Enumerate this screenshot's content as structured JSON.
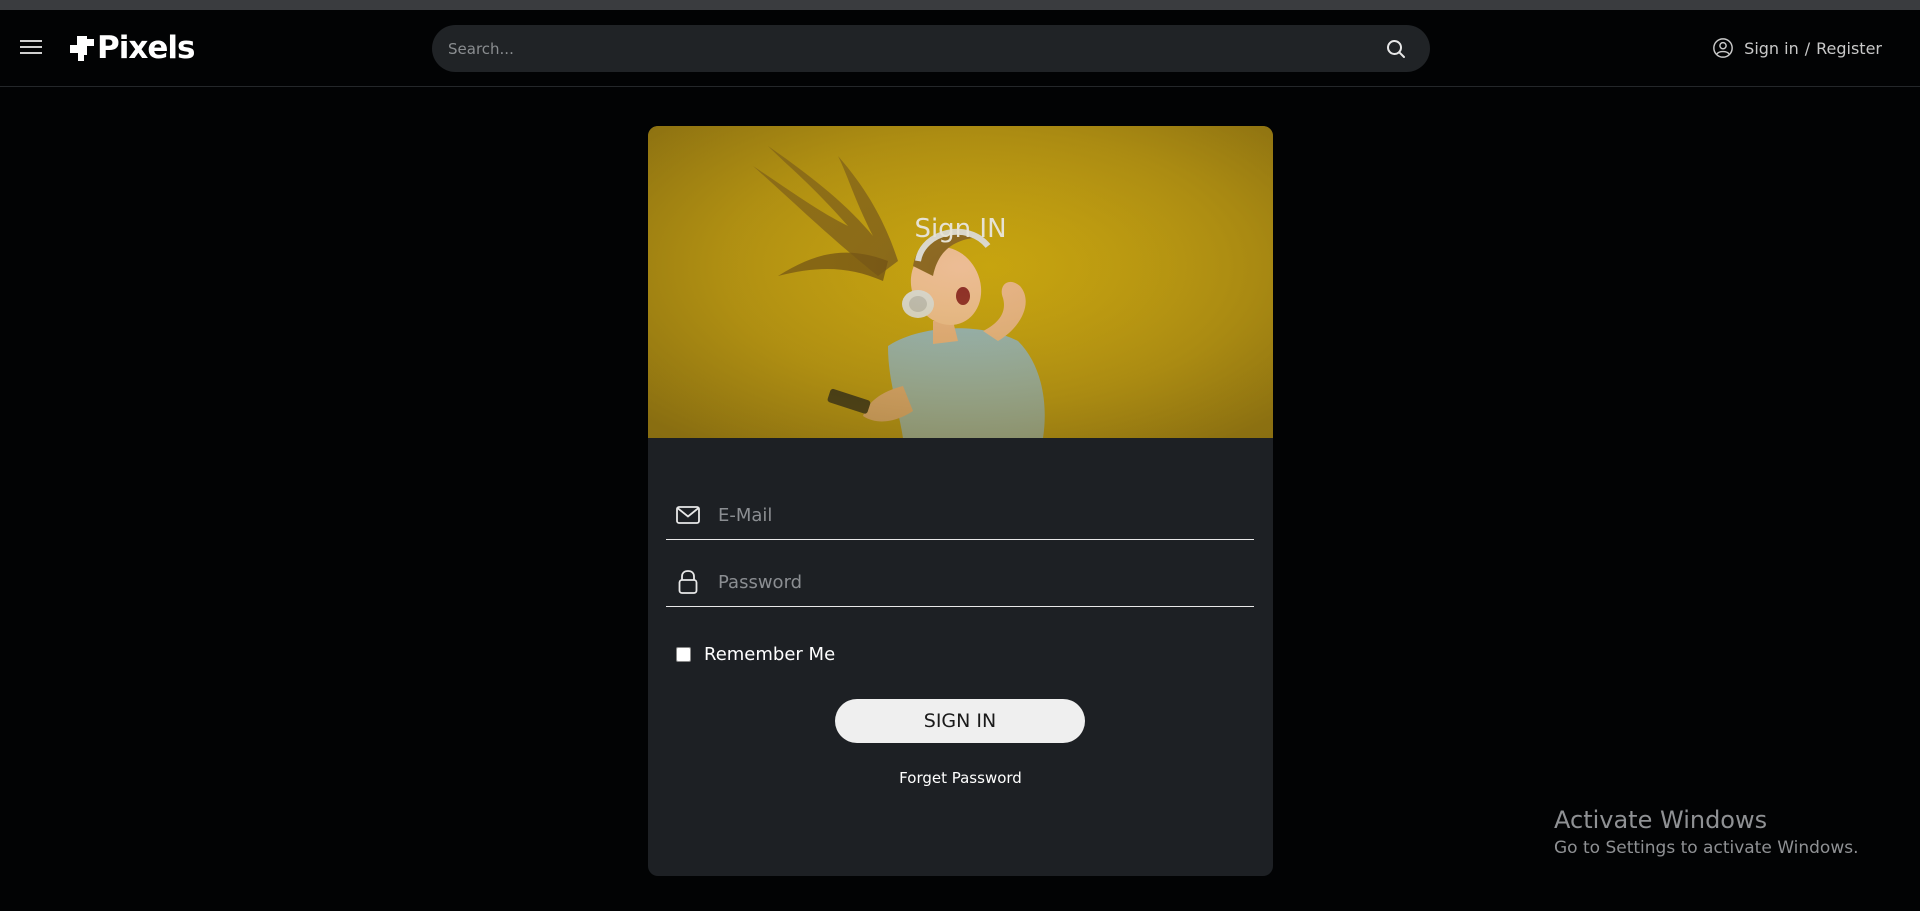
{
  "header": {
    "brand": "Pixels",
    "search_placeholder": "Search...",
    "signin_label": "Sign in",
    "separator": "/",
    "register_label": "Register"
  },
  "signin_card": {
    "title": "Sign IN",
    "email_placeholder": "E-Mail",
    "password_placeholder": "Password",
    "remember_label": "Remember Me",
    "remember_checked": false,
    "submit_label": "SIGN IN",
    "forget_label": "Forget Password"
  },
  "os_watermark": {
    "title": "Activate Windows",
    "subtitle": "Go to Settings to activate Windows."
  },
  "colors": {
    "background": "#020304",
    "card": "#1d2024",
    "hero_yellow": "#c7a40f",
    "search_bg": "#202326"
  },
  "icons": [
    "menu-icon",
    "logo-icon",
    "search-icon",
    "user-circle-icon",
    "mail-icon",
    "lock-icon"
  ]
}
